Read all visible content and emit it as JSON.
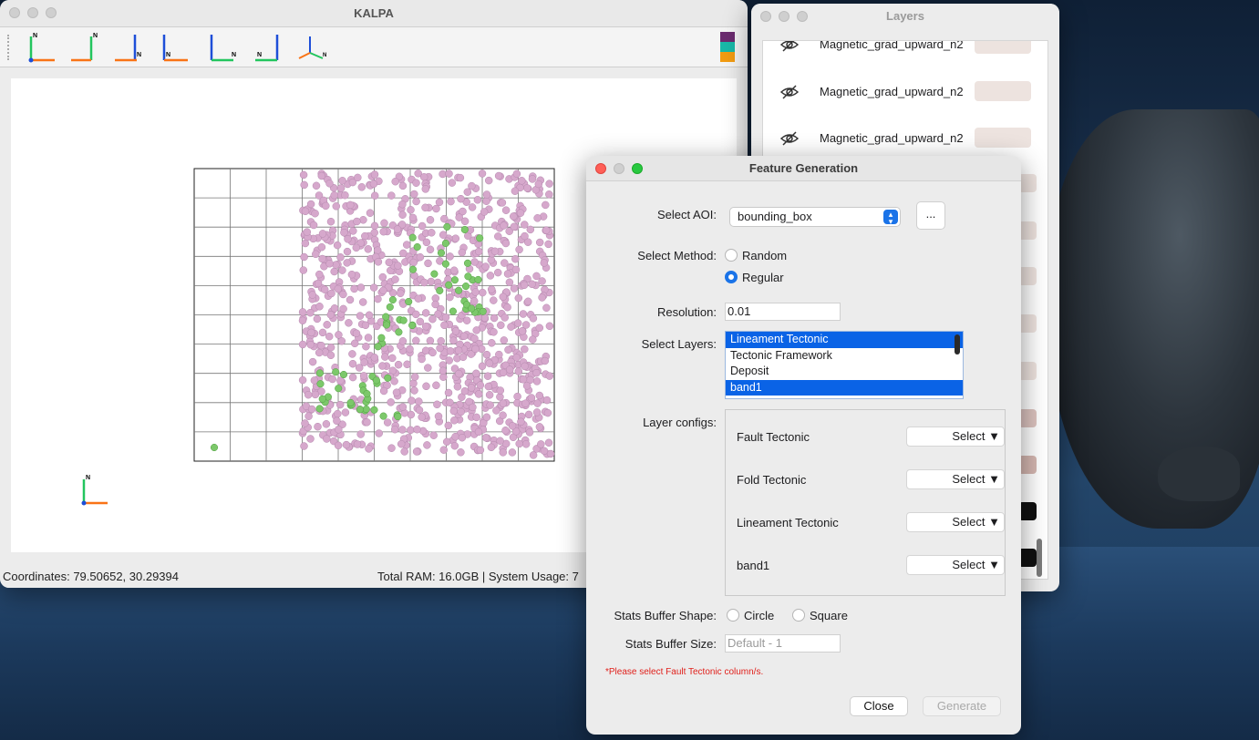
{
  "kalpa": {
    "title": "KALPA",
    "legend_colors": [
      "#6a2b6e",
      "#19b8a8",
      "#f39c12"
    ],
    "status": {
      "coordinates": "Coordinates: 79.50652, 30.29394",
      "system": "Total RAM: 16.0GB | System Usage: 7"
    },
    "axis_north_label": "N"
  },
  "layers_window": {
    "title": "Layers",
    "items": [
      {
        "name": "Magnetic_grad_upward_n2",
        "color": "#ede3df"
      },
      {
        "name": "Magnetic_grad_upward_n2",
        "color": "#ede3df"
      },
      {
        "name": "Magnetic_grad_upward_n2",
        "color": "#ede3df"
      }
    ]
  },
  "feature_generation": {
    "title": "Feature Generation",
    "aoi": {
      "label": "Select AOI:",
      "value": "bounding_box",
      "more_button": "..."
    },
    "method": {
      "label": "Select Method:",
      "options": [
        "Random",
        "Regular"
      ],
      "selected": "Regular"
    },
    "resolution": {
      "label": "Resolution:",
      "value": "0.01"
    },
    "layers": {
      "label": "Select Layers:",
      "items": [
        {
          "name": "Lineament Tectonic",
          "selected": true
        },
        {
          "name": "Tectonic Framework",
          "selected": false
        },
        {
          "name": "Deposit",
          "selected": false
        },
        {
          "name": "band1",
          "selected": true
        }
      ]
    },
    "layer_configs": {
      "label": "Layer configs:",
      "rows": [
        {
          "name": "Fault Tectonic",
          "button": "Select ▼"
        },
        {
          "name": "Fold Tectonic",
          "button": "Select ▼"
        },
        {
          "name": "Lineament Tectonic",
          "button": "Select ▼"
        },
        {
          "name": "band1",
          "button": "Select ▼"
        }
      ]
    },
    "buffer_shape": {
      "label": "Stats Buffer Shape:",
      "options": [
        "Circle",
        "Square"
      ]
    },
    "buffer_size": {
      "label": "Stats Buffer Size:",
      "placeholder": "Default - 1"
    },
    "warning": "*Please select Fault Tectonic column/s.",
    "close_button": "Close",
    "generate_button": "Generate"
  }
}
